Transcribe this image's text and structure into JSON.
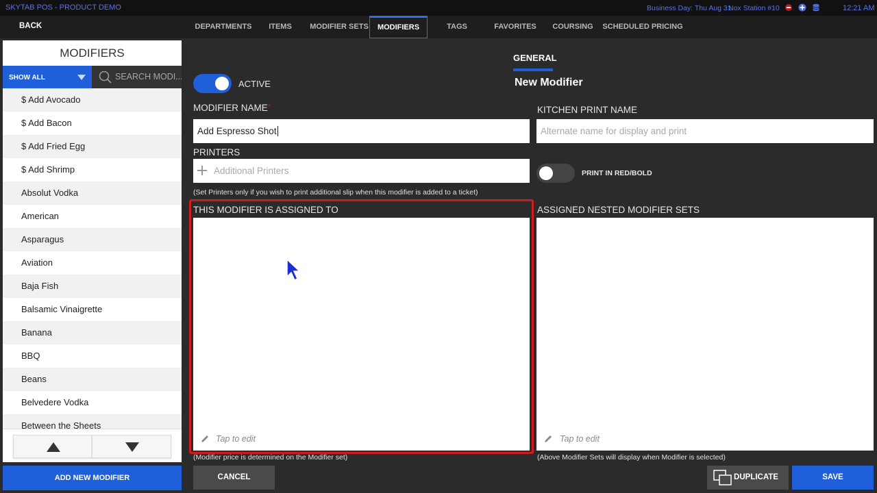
{
  "topbar": {
    "app_title": "SKYTAB POS - PRODUCT DEMO",
    "business_day": "Business Day: Thu Aug 31",
    "station": "Nox Station  #10",
    "time": "12:21 AM"
  },
  "nav": {
    "back": "BACK",
    "tabs": [
      "DEPARTMENTS",
      "ITEMS",
      "MODIFIER SETS",
      "MODIFIERS",
      "TAGS",
      "FAVORITES",
      "COURSING",
      "SCHEDULED PRICING"
    ],
    "active_tab": "MODIFIERS"
  },
  "sidebar": {
    "title": "MODIFIERS",
    "filter": "SHOW ALL",
    "search_placeholder": "SEARCH MODI...",
    "items": [
      "$ Add Avocado",
      "$ Add Bacon",
      "$ Add Fried Egg",
      "$ Add Shrimp",
      "Absolut Vodka",
      "American",
      "Asparagus",
      "Aviation",
      "Baja Fish",
      "Balsamic Vinaigrette",
      "Banana",
      "BBQ",
      "Beans",
      "Belvedere Vodka",
      "Between the Sheets"
    ],
    "add_button": "ADD NEW MODIFIER"
  },
  "form": {
    "general_tab": "GENERAL",
    "heading": "New Modifier",
    "active_label": "ACTIVE",
    "active_on": true,
    "modifier_name_label": "MODIFIER NAME",
    "required_mark": "*",
    "modifier_name_value": "Add Espresso Shot",
    "kitchen_print_label": "KITCHEN PRINT NAME",
    "kitchen_print_placeholder": "Alternate name for display and print",
    "printers_label": "PRINTERS",
    "printers_placeholder": "Additional Printers",
    "printers_note": "(Set Printers only if you wish to print additional slip when this modifier is added to a ticket)",
    "print_red_label": "PRINT IN RED/BOLD",
    "print_red_on": false,
    "assigned_to_label": "THIS MODIFIER IS ASSIGNED TO",
    "nested_label": "ASSIGNED NESTED MODIFIER SETS",
    "tap_to_edit": "Tap to edit",
    "assigned_note": "(Modifier price is determined on the Modifier set)",
    "nested_note": "(Above Modifier Sets will display when Modifier is selected)"
  },
  "footer": {
    "cancel": "CANCEL",
    "duplicate": "DUPLICATE",
    "save": "SAVE"
  },
  "colors": {
    "accent": "#1f5fd9",
    "highlight": "#d01c1c",
    "topbar_text": "#5b74e6"
  }
}
